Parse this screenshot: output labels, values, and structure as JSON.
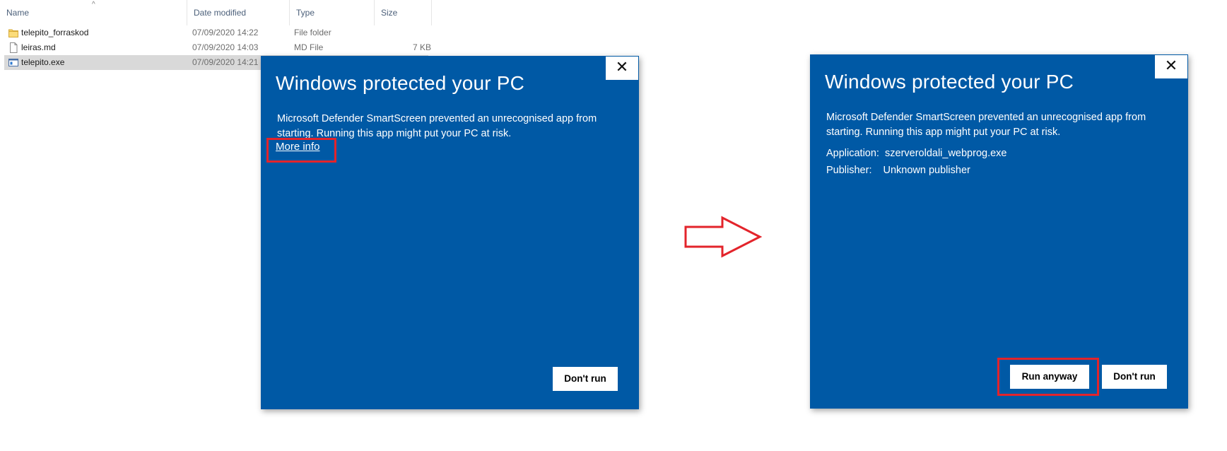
{
  "explorer": {
    "columns": {
      "name": "Name",
      "date": "Date modified",
      "type": "Type",
      "size": "Size"
    },
    "sort_indicator": "^",
    "files": [
      {
        "name": "telepito_forraskod",
        "date": "07/09/2020 14:22",
        "type": "File folder",
        "size": "",
        "icon": "folder-icon",
        "selected": false
      },
      {
        "name": "leiras.md",
        "date": "07/09/2020 14:03",
        "type": "MD File",
        "size": "7 KB",
        "icon": "document-icon",
        "selected": false
      },
      {
        "name": "telepito.exe",
        "date": "07/09/2020 14:21",
        "type": "",
        "size": "",
        "icon": "application-icon",
        "selected": true
      }
    ]
  },
  "dialog_left": {
    "title": "Windows protected your PC",
    "body": "Microsoft Defender SmartScreen prevented an unrecognised app from starting. Running this app might put your PC at risk.",
    "more_info": "More info",
    "dont_run": "Don't run",
    "close": "✕"
  },
  "dialog_right": {
    "title": "Windows protected your PC",
    "body": "Microsoft Defender SmartScreen prevented an unrecognised app from starting. Running this app might put your PC at risk.",
    "application_label": "Application:",
    "application_value": "szerveroldali_webprog.exe",
    "publisher_label": "Publisher:",
    "publisher_value": "Unknown publisher",
    "run_anyway": "Run anyway",
    "dont_run": "Don't run",
    "close": "✕"
  },
  "colors": {
    "dialog_bg": "#0059a5",
    "annotation": "#e3242b",
    "selected_row": "#d9d9d9"
  }
}
